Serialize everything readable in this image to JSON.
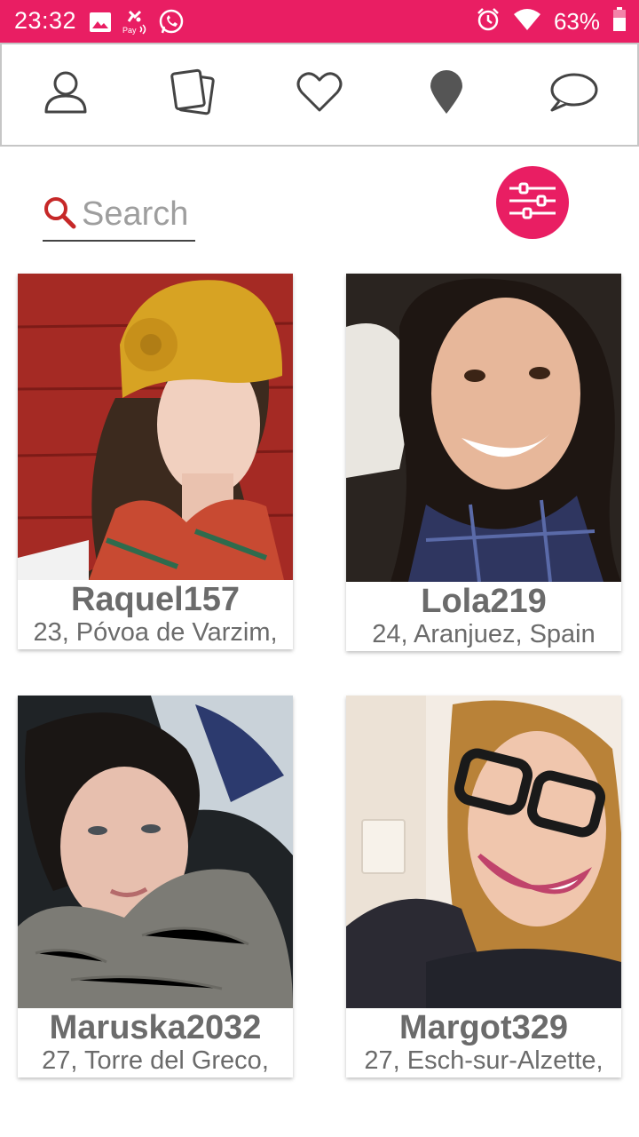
{
  "status_bar": {
    "time": "23:32",
    "battery": "63%",
    "color": "#e91e63",
    "left_icons": [
      "image-icon",
      "caixa-pay-icon",
      "whatsapp-icon"
    ],
    "right_icons": [
      "alarm-icon",
      "wifi-icon",
      "battery-icon"
    ]
  },
  "nav": {
    "items": [
      {
        "name": "profile",
        "icon": "user-icon"
      },
      {
        "name": "cards",
        "icon": "cards-icon"
      },
      {
        "name": "likes",
        "icon": "heart-icon"
      },
      {
        "name": "nearby",
        "icon": "location-pin-icon"
      },
      {
        "name": "messages",
        "icon": "chat-bubble-icon"
      }
    ]
  },
  "search": {
    "placeholder": "Search",
    "value": "",
    "icon": "search-icon"
  },
  "filter_button": {
    "icon": "filter-sliders-icon",
    "color": "#e91e63"
  },
  "profiles": [
    {
      "name": "Raquel157",
      "details": "23, Póvoa de Varzim,"
    },
    {
      "name": "Lola219",
      "details": "24, Aranjuez, Spain"
    },
    {
      "name": "Maruska2032",
      "details": "27, Torre del Greco,"
    },
    {
      "name": "Margot329",
      "details": "27, Esch-sur-Alzette,"
    }
  ]
}
